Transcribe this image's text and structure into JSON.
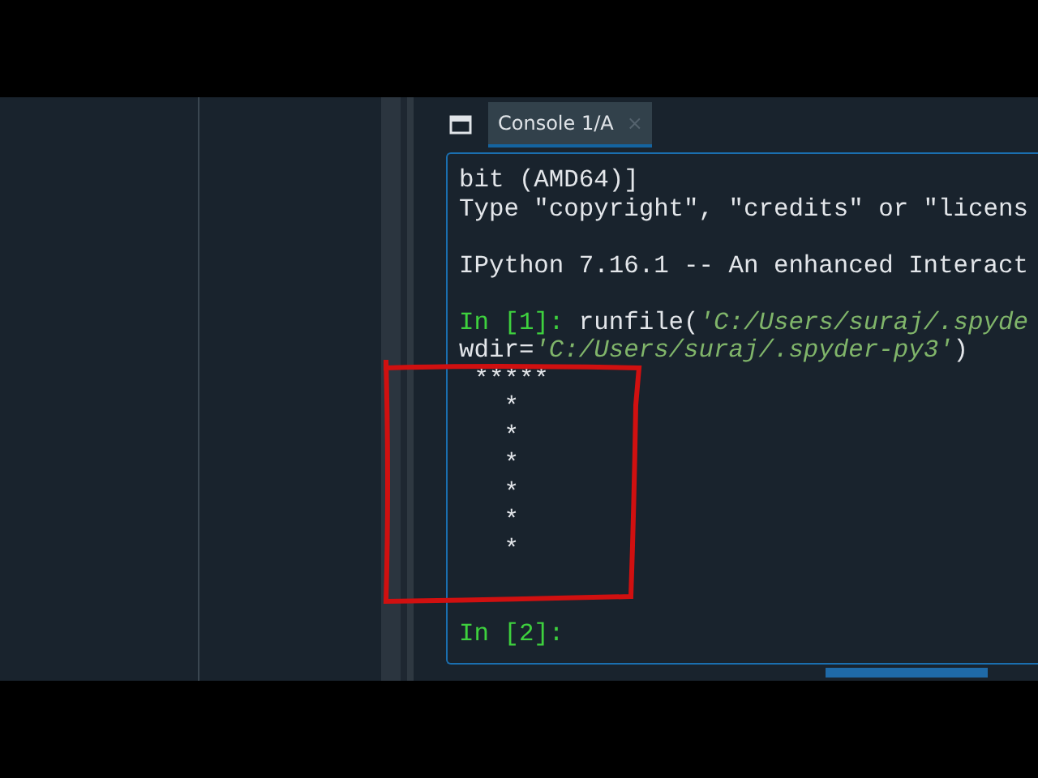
{
  "console_tab": {
    "label": "Console 1/A",
    "close": "×",
    "selected": true
  },
  "console": {
    "lines": [
      {
        "kind": "plain",
        "segments": [
          {
            "kind": "output",
            "text": "bit (AMD64)]"
          }
        ]
      },
      {
        "kind": "plain",
        "segments": [
          {
            "kind": "output",
            "text": "Type \"copyright\", \"credits\" or \"licens"
          }
        ]
      },
      {
        "kind": "spaced",
        "segments": [
          {
            "kind": "output",
            "text": "IPython 7.16.1 -- An enhanced Interact"
          }
        ]
      },
      {
        "kind": "spaced",
        "segments": [
          {
            "kind": "prompt",
            "text": "In [1]:"
          },
          {
            "kind": "code",
            "text": " runfile("
          },
          {
            "kind": "string",
            "text": "'C:/Users/suraj/.spyde"
          }
        ]
      },
      {
        "kind": "plain",
        "segments": [
          {
            "kind": "code",
            "text": "wdir="
          },
          {
            "kind": "string",
            "text": "'C:/Users/suraj/.spyder-py3'"
          },
          {
            "kind": "code",
            "text": ")"
          }
        ]
      },
      {
        "kind": "plain",
        "segments": [
          {
            "kind": "output",
            "text": " *****"
          }
        ]
      },
      {
        "kind": "plain",
        "segments": [
          {
            "kind": "output",
            "text": "   *"
          }
        ]
      },
      {
        "kind": "plain",
        "segments": [
          {
            "kind": "output",
            "text": "   *"
          }
        ]
      },
      {
        "kind": "plain",
        "segments": [
          {
            "kind": "output",
            "text": "   *"
          }
        ]
      },
      {
        "kind": "plain",
        "segments": [
          {
            "kind": "output",
            "text": "   *"
          }
        ]
      },
      {
        "kind": "plain",
        "segments": [
          {
            "kind": "output",
            "text": "   *"
          }
        ]
      },
      {
        "kind": "plain",
        "segments": [
          {
            "kind": "output",
            "text": "   *"
          }
        ]
      },
      {
        "kind": "doublespaced",
        "segments": [
          {
            "kind": "prompt",
            "text": "In [2]:"
          }
        ]
      }
    ]
  }
}
